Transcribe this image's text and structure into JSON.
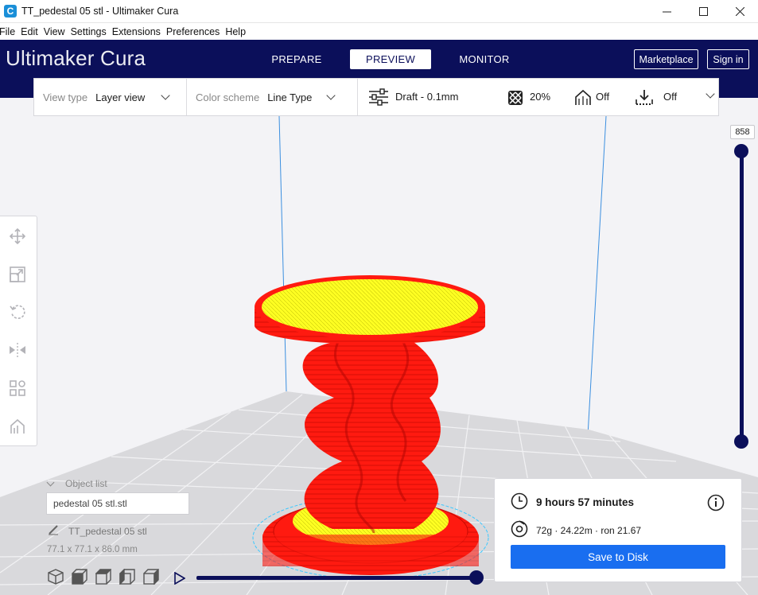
{
  "window": {
    "title": "TT_pedestal 05  stl - Ultimaker Cura",
    "app_icon": "C",
    "controls": [
      "minimize-icon",
      "maximize-icon",
      "close-icon"
    ]
  },
  "menu": [
    "File",
    "Edit",
    "View",
    "Settings",
    "Extensions",
    "Preferences",
    "Help"
  ],
  "header": {
    "logo_light": "Ultimaker",
    "logo_bold": "Cura",
    "tabs": [
      {
        "label": "PREPARE",
        "active": false
      },
      {
        "label": "PREVIEW",
        "active": true
      },
      {
        "label": "MONITOR",
        "active": false
      }
    ],
    "marketplace": "Marketplace",
    "sign_in": "Sign in",
    "color": "#0b0f5a"
  },
  "toolbar": {
    "view_type_label": "View type",
    "view_type_value": "Layer view",
    "color_scheme_label": "Color scheme",
    "color_scheme_value": "Line Type",
    "profile": "Draft - 0.1mm",
    "infill": "20%",
    "support": "Off",
    "adhesion": "Off"
  },
  "tools": [
    "move-icon",
    "scale-icon",
    "rotate-icon",
    "mirror-icon",
    "per-model-settings-icon",
    "support-blocker-icon"
  ],
  "layer_slider": {
    "current_layer": "858",
    "fill": 1.0
  },
  "object_list": {
    "toggle_label": "Object list",
    "file": "pedestal 05  stl.stl",
    "object_name": "TT_pedestal 05  stl",
    "dimensions": "77.1 x 77.1 x 86.0 mm"
  },
  "simulation": {
    "progress": 1.0
  },
  "print_info": {
    "time": "9 hours 57 minutes",
    "material": "72g · 24.22m · ron 21.67",
    "save_label": "Save to Disk",
    "accent": "#196ef0"
  },
  "model_colors": {
    "walls": "#ff1a10",
    "skin": "#ffff22",
    "shell": "#3cc8ff"
  }
}
